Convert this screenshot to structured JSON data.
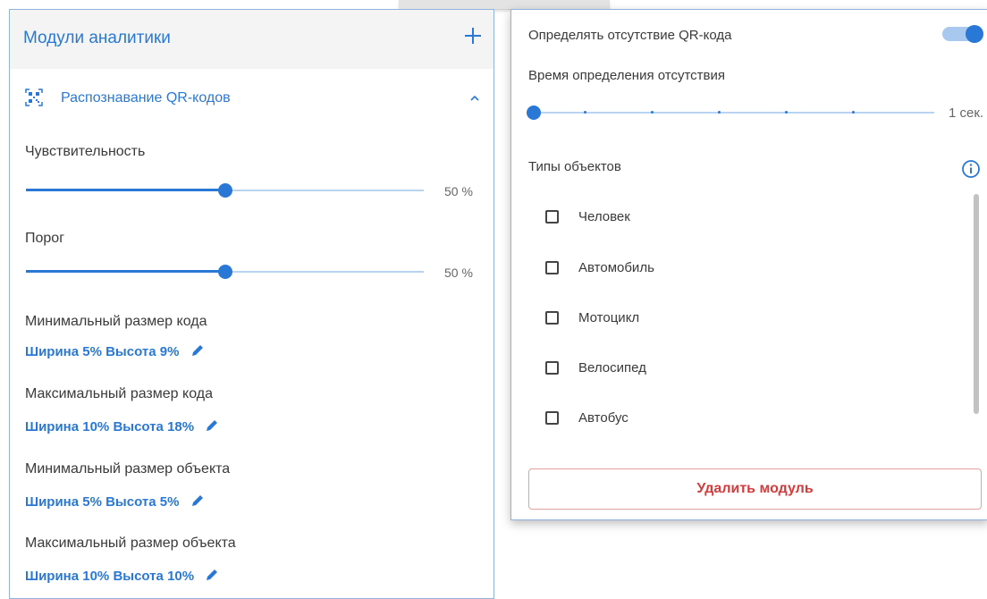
{
  "left_panel": {
    "title": "Модули аналитики",
    "section": {
      "title": "Распознавание QR-кодов",
      "expanded": true
    },
    "sensitivity": {
      "label": "Чувствительность",
      "value": 0.5,
      "value_text": "50 %"
    },
    "threshold": {
      "label": "Порог",
      "value": 0.5,
      "value_text": "50 %"
    },
    "min_code_size": {
      "label": "Минимальный размер кода",
      "value": "Ширина 5% Высота 9%"
    },
    "max_code_size": {
      "label": "Максимальный размер кода",
      "value": "Ширина 10% Высота 18%"
    },
    "min_object_size": {
      "label": "Минимальный размер объекта",
      "value": "Ширина 5% Высота 5%"
    },
    "max_object_size": {
      "label": "Максимальный размер объекта",
      "value": "Ширина 10% Высота 10%"
    }
  },
  "right_panel": {
    "detect_absence": {
      "label": "Определять отсутствие QR-кода",
      "enabled": true
    },
    "absence_time": {
      "label": "Время определения отсутствия",
      "value": 0,
      "value_text": "1 сек."
    },
    "object_types": {
      "label": "Типы объектов",
      "items": [
        {
          "label": "Человек",
          "checked": false
        },
        {
          "label": "Автомобиль",
          "checked": false
        },
        {
          "label": "Мотоцикл",
          "checked": false
        },
        {
          "label": "Велосипед",
          "checked": false
        },
        {
          "label": "Автобус",
          "checked": false
        }
      ]
    },
    "delete_button": "Удалить модуль"
  },
  "colors": {
    "accent": "#2a78d6",
    "danger": "#d63a3a",
    "track": "#b9d4f2",
    "panel_border": "#8fb3dc"
  },
  "icons": [
    "plus-icon",
    "qr-code-icon",
    "chevron-up-icon",
    "pencil-icon",
    "info-icon",
    "checkbox-icon"
  ]
}
